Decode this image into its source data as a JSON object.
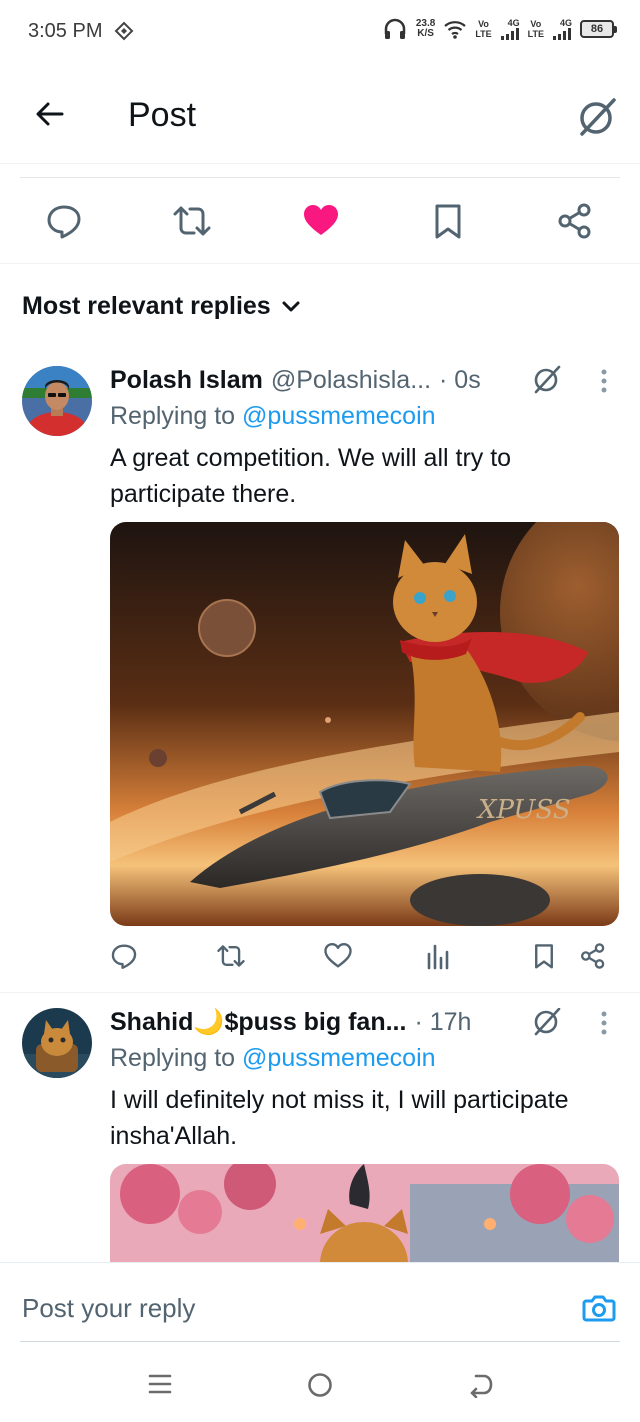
{
  "status": {
    "time": "3:05 PM",
    "net_speed_value": "23.8",
    "net_speed_unit": "K/S",
    "sim1_vo": "Vo",
    "sim1_lte": "LTE",
    "sim1_gen": "4G",
    "sim2_vo": "Vo",
    "sim2_lte": "LTE",
    "sim2_gen": "4G",
    "battery": "86"
  },
  "header": {
    "title": "Post"
  },
  "sort": {
    "label": "Most relevant replies"
  },
  "colors": {
    "like": "#f91880",
    "link": "#1d9bf0",
    "muted": "#536471",
    "camera": "#1d9bf0"
  },
  "replies": [
    {
      "author": "Polash Islam",
      "handle": "@Polashisla...",
      "time": "· 0s",
      "replying_prefix": "Replying to ",
      "replying_to": "@pussmemecoin",
      "text": "A great competition. We will all try to participate there.",
      "media_text": "XPUSS"
    },
    {
      "author": "Shahid🌙$puss big fan...",
      "handle": "",
      "time": "· 17h",
      "replying_prefix": "Replying to ",
      "replying_to": "@pussmemecoin",
      "text": "I will definitely not miss it, I will participate insha'Allah."
    }
  ],
  "compose": {
    "placeholder": "Post your reply"
  },
  "icons": {
    "back": "arrow-left-icon",
    "grok": "grok-icon",
    "reply": "comment-icon",
    "repost": "repost-icon",
    "like": "heart-icon",
    "bookmark": "bookmark-icon",
    "share": "share-icon",
    "views": "bar-chart-icon",
    "more": "more-vertical-icon",
    "camera": "camera-icon"
  }
}
